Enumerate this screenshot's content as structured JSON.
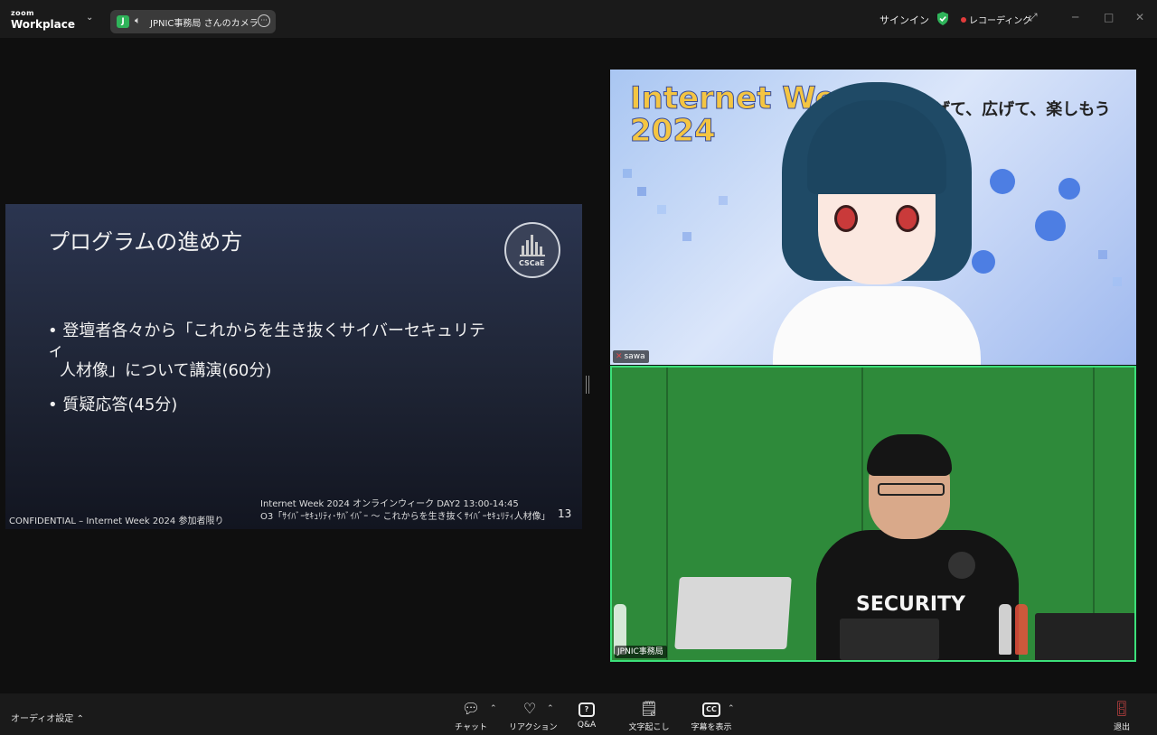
{
  "titlebar": {
    "brand_top": "zoom",
    "brand_main": "Workplace",
    "camera_initial": "J",
    "camera_label": "JPNIC事務局 さんのカメラ",
    "signin": "サインイン",
    "recording": "レコーディング"
  },
  "slide": {
    "title": "プログラムの進め方",
    "logo_text": "CSCaE",
    "bullet1_line1": "登壇者各々から「これからを生き抜くサイバーセキュリティ",
    "bullet1_line2": "人材像」について講演(60分)",
    "bullet2": "質疑応答(45分)",
    "footer_left": "CONFIDENTIAL – Internet Week 2024 参加者限り",
    "footer_center_1": "Internet Week 2024 オンラインウィーク DAY2 13:00-14:45",
    "footer_center_2": "O3「ｻｲﾊﾞｰｾｷｭﾘﾃｨ･ｻﾊﾞｲﾊﾞｰ 〜 これからを生き抜くｻｲﾊﾞｰｾｷｭﾘﾃｨ人材像」",
    "page_number": "13"
  },
  "tiles": {
    "tile1_banner": "Internet Week\n2024",
    "tile1_tagline": "げて、広げて、楽しもう",
    "tile1_name": "sawa",
    "tile2_shirt": "SECURITY",
    "tile2_name": "JPNIC事務局"
  },
  "toolbar": {
    "audio": "オーディオ設定",
    "chat": "チャット",
    "reactions": "リアクション",
    "qa": "Q&A",
    "transcript": "文字起こし",
    "captions": "字幕を表示",
    "leave": "退出",
    "qa_icon_text": "?",
    "cc_icon_text": "CC"
  },
  "colors": {
    "accent_green": "#3ce07a",
    "record_red": "#e23b3b",
    "leave_red": "#e24a4a"
  }
}
